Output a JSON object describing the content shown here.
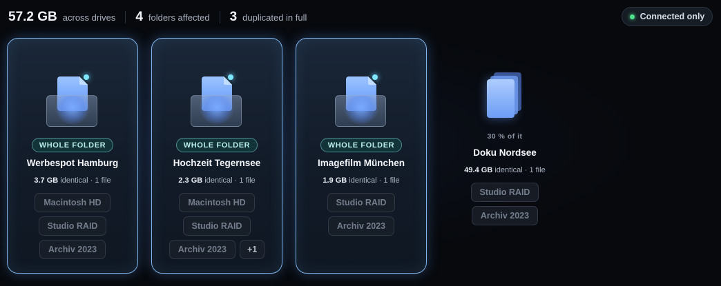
{
  "summary": {
    "total_size": "57.2 GB",
    "total_size_label": "across drives",
    "folders_count": "4",
    "folders_label": "folders affected",
    "duplicated_count": "3",
    "duplicated_label": "duplicated in full"
  },
  "filter": {
    "label": "Connected only",
    "status_color": "#4ee08b"
  },
  "cards": [
    {
      "badge": "WHOLE FOLDER",
      "title": "Werbespot Hamburg",
      "size": "3.7 GB",
      "meta": " identical · 1 file",
      "drives": [
        "Macintosh HD",
        "Studio RAID",
        "Archiv 2023"
      ],
      "icon": "folder-icon"
    },
    {
      "badge": "WHOLE FOLDER",
      "title": "Hochzeit Tegernsee",
      "size": "2.3 GB",
      "meta": " identical · 1 file",
      "drives": [
        "Macintosh HD",
        "Studio RAID",
        "Archiv 2023"
      ],
      "more": "+1",
      "icon": "folder-icon"
    },
    {
      "badge": "WHOLE FOLDER",
      "title": "Imagefilm München",
      "size": "1.9 GB",
      "meta": " identical · 1 file",
      "drives": [
        "Studio RAID",
        "Archiv 2023"
      ],
      "icon": "folder-icon"
    },
    {
      "portion": "30 % of it",
      "title": "Doku Nordsee",
      "size": "49.4 GB",
      "meta": " identical · 1 file",
      "drives": [
        "Studio RAID",
        "Archiv 2023"
      ],
      "icon": "files-icon"
    }
  ],
  "colors": {
    "accent_border": "#7fb3ea",
    "badge_text": "#b9ecea",
    "background": "#07090d"
  }
}
